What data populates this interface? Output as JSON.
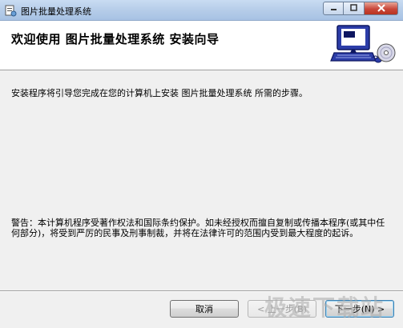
{
  "window": {
    "title": "图片批量处理系统",
    "controls": {
      "minimize": "▭",
      "maximize": "▢",
      "close": "✕"
    }
  },
  "header": {
    "title": "欢迎使用 图片批量处理系统 安装向导"
  },
  "content": {
    "intro": "安装程序将引导您完成在您的计算机上安装 图片批量处理系统 所需的步骤。",
    "warning": "警告：本计算机程序受著作权法和国际条约保护。如未经授权而擅自复制或传播本程序(或其中任何部分)，将受到严厉的民事及刑事制裁，并将在法律许可的范围内受到最大程度的起诉。"
  },
  "buttons": {
    "cancel": "取消",
    "prev": "< 上一步(B)",
    "next": "下一步(N) >"
  },
  "watermark": "极速下载站",
  "colors": {
    "titlebar": "#b6cde9",
    "header_bg": "#ffffff",
    "body_bg": "#f0f0f0",
    "close_button": "#c9473a"
  },
  "icons": {
    "app": "installer-app-icon",
    "header_art": "computer-with-disc-icon"
  }
}
